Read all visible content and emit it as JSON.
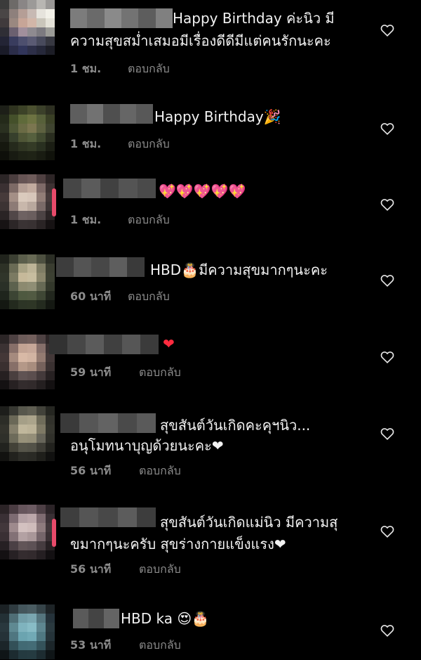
{
  "comments": [
    {
      "text1": "Happy Birthday ค่ะนิว มี",
      "text2": "ความสุขสม่ำเสมอมีเรื่องดีดีมีแต่คนรักนะคะ",
      "time": "1 ชม.",
      "reply": "ตอบกลับ"
    },
    {
      "text1": "Happy Birthday🎉",
      "time": "1 ชม.",
      "reply": "ตอบกลับ"
    },
    {
      "text1": "💖💖💖💖💖",
      "time": "1 ชม.",
      "reply": "ตอบกลับ"
    },
    {
      "text1": "HBD🎂มีความสุขมากๆนะคะ",
      "time": "60 นาที",
      "reply": "ตอบกลับ"
    },
    {
      "text1": "❤",
      "time": "59 นาที",
      "reply": "ตอบกลับ"
    },
    {
      "text1": "สุขสันต์วันเกิดคะคุฯนิว...",
      "text2": "อนุโมทนาบุญด้วยนะคะ❤",
      "time": "56 นาที",
      "reply": "ตอบกลับ"
    },
    {
      "text1": "สุขสันต์วันเกิดแม่นิว มีความสุ",
      "text2": "ขมากๆนะครับ สุขร่างกายแข็งแรง❤",
      "time": "56 นาที",
      "reply": "ตอบกลับ"
    },
    {
      "text1": "HBD ka 😍🎂",
      "time": "53 นาที",
      "reply": "ตอบกลับ"
    }
  ],
  "icons": {
    "like": "heart-outline-icon"
  },
  "colors": {
    "background": "#000000",
    "text": "#f2f2f2",
    "meta": "#8c8c8c",
    "heart": "#ff2b3f"
  }
}
